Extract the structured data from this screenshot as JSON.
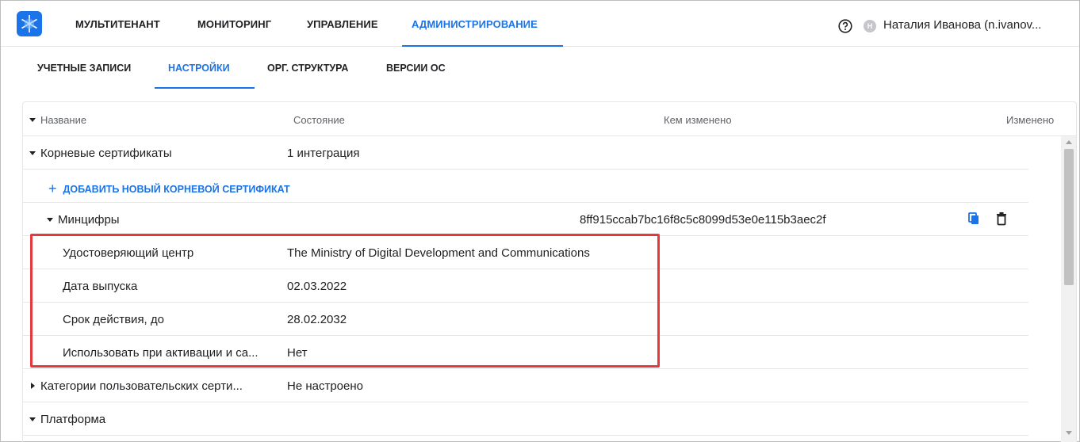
{
  "nav": {
    "items": [
      {
        "label": "МУЛЬТИТЕНАНТ"
      },
      {
        "label": "МОНИТОРИНГ"
      },
      {
        "label": "УПРАВЛЕНИЕ"
      },
      {
        "label": "АДМИНИСТРИРОВАНИЕ",
        "active": true
      }
    ],
    "user_initial": "Н",
    "user_name": "Наталия Иванова (n.ivanov..."
  },
  "subtabs": [
    {
      "label": "УЧЕТНЫЕ ЗАПИСИ"
    },
    {
      "label": "НАСТРОЙКИ",
      "active": true
    },
    {
      "label": "ОРГ. СТРУКТУРА"
    },
    {
      "label": "ВЕРСИИ ОС"
    }
  ],
  "table": {
    "headers": {
      "name": "Название",
      "state": "Состояние",
      "changed_by": "Кем изменено",
      "changed": "Изменено"
    },
    "rows": {
      "root_certs": {
        "name": "Корневые сертификаты",
        "state": "1 интеграция"
      },
      "add_link": "ДОБАВИТЬ НОВЫЙ КОРНЕВОЙ СЕРТИФИКАТ",
      "mincifry": {
        "name": "Минцифры",
        "hash": "8ff915ccab7bc16f8c5c8099d53e0e115b3aec2f"
      },
      "details": [
        {
          "label": "Удостоверяющий центр",
          "value": "The Ministry of Digital Development and Communications"
        },
        {
          "label": "Дата выпуска",
          "value": "02.03.2022"
        },
        {
          "label": "Срок действия, до",
          "value": "28.02.2032"
        },
        {
          "label": "Использовать при активации и са...",
          "value": "Нет"
        }
      ],
      "user_certs": {
        "name": "Категории пользовательских серти...",
        "state": "Не настроено"
      },
      "platform": {
        "name": "Платформа"
      }
    }
  },
  "colors": {
    "accent": "#1a73e8",
    "highlight": "#e5393e"
  },
  "icons": [
    "logo-icon",
    "help-icon",
    "copy-icon",
    "trash-icon",
    "plus-icon",
    "caret-down-icon",
    "caret-right-icon"
  ]
}
